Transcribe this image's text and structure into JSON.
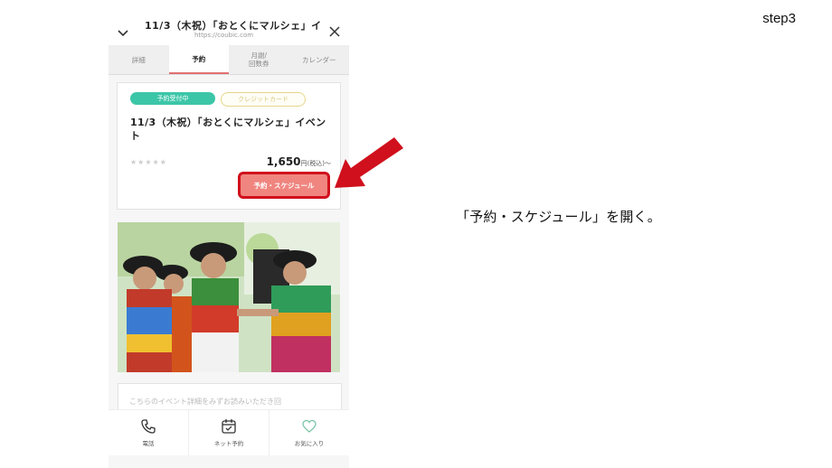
{
  "step_label": "step3",
  "window": {
    "title": "11/3（木祝）「おとくにマルシェ」イ…",
    "url": "https://coubic.com"
  },
  "tabs": [
    {
      "label": "詳細",
      "active": false
    },
    {
      "label": "予約",
      "active": true
    },
    {
      "label": "月謝/\n回数券",
      "active": false
    },
    {
      "label": "カレンダー",
      "active": false
    }
  ],
  "event": {
    "badge_status": "予約受付中",
    "badge_payment": "クレジットカード",
    "title": "11/3（木祝）「おとくにマルシェ」イベント",
    "rating": "★★★★★",
    "price": "1,650",
    "price_suffix": "円(税込)〜",
    "reserve_button": "予約・スケジュール"
  },
  "second_card_text": "こちらのイベント詳細をみずお読みいただき回",
  "bottom_nav": [
    {
      "label": "電話",
      "icon": "phone-icon"
    },
    {
      "label": "ネット予約",
      "icon": "calendar-icon"
    },
    {
      "label": "お気に入り",
      "icon": "heart-icon"
    }
  ],
  "instruction": "「予約・スケジュール」を開く。",
  "colors": {
    "accent_green": "#3cc6a8",
    "button_pink": "#f0857f",
    "highlight_red": "#d0101c",
    "tab_underline": "#e07070"
  }
}
